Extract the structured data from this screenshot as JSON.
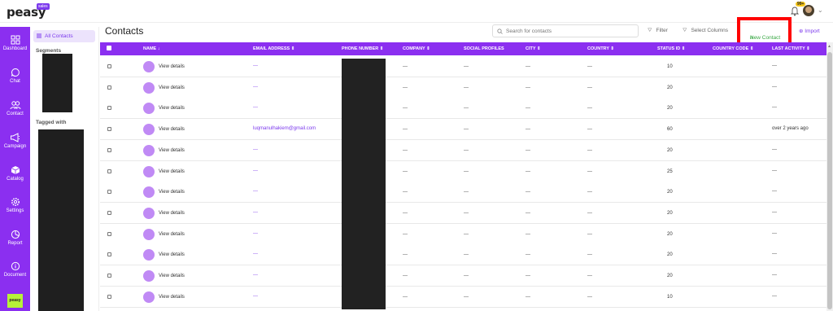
{
  "app": {
    "logo": "peasy",
    "logo_badge": "sales",
    "new_badge": "99+"
  },
  "nav": [
    {
      "label": "Dashboard",
      "icon": "grid-icon"
    },
    {
      "label": "Chat",
      "icon": "chat-icon"
    },
    {
      "label": "Contact",
      "icon": "contacts-icon"
    },
    {
      "label": "Campaign",
      "icon": "megaphone-icon"
    },
    {
      "label": "Catalog",
      "icon": "box-icon"
    },
    {
      "label": "Settings",
      "icon": "gear-icon"
    },
    {
      "label": "Report",
      "icon": "pie-chart-icon"
    },
    {
      "label": "Document",
      "icon": "info-icon"
    }
  ],
  "nav_bottom_logo": "peasy",
  "segments": {
    "all_contacts": "All Contacts",
    "segments_heading": "Segments",
    "tagged_heading": "Tagged with"
  },
  "page": {
    "title": "Contacts",
    "search_placeholder": "Search for contacts",
    "filter": "Filter",
    "select_columns": "Select Columns",
    "new_contact": "New Contact",
    "import": "Import"
  },
  "table": {
    "columns": [
      "NAME",
      "EMAIL ADDRESS",
      "PHONE NUMBER",
      "COMPANY",
      "SOCIAL PROFILES",
      "CITY",
      "COUNTRY",
      "STATUS ID",
      "COUNTRY CODE",
      "LAST ACTIVITY"
    ],
    "view_label": "View details",
    "rows": [
      {
        "email": "---",
        "company": "---",
        "social": "---",
        "city": "---",
        "country": "---",
        "status": "10",
        "code": "",
        "activity": "---"
      },
      {
        "email": "---",
        "company": "---",
        "social": "---",
        "city": "---",
        "country": "---",
        "status": "20",
        "code": "",
        "activity": "---"
      },
      {
        "email": "---",
        "company": "---",
        "social": "---",
        "city": "---",
        "country": "---",
        "status": "20",
        "code": "",
        "activity": "---"
      },
      {
        "email": "luqmanulhakiem@gmail.com",
        "company": "---",
        "social": "---",
        "city": "---",
        "country": "---",
        "status": "60",
        "code": "",
        "activity": "over 2 years ago"
      },
      {
        "email": "---",
        "company": "---",
        "social": "---",
        "city": "---",
        "country": "---",
        "status": "20",
        "code": "",
        "activity": "---"
      },
      {
        "email": "---",
        "company": "---",
        "social": "---",
        "city": "---",
        "country": "---",
        "status": "25",
        "code": "",
        "activity": "---"
      },
      {
        "email": "---",
        "company": "---",
        "social": "---",
        "city": "---",
        "country": "---",
        "status": "20",
        "code": "",
        "activity": "---"
      },
      {
        "email": "---",
        "company": "---",
        "social": "---",
        "city": "---",
        "country": "---",
        "status": "20",
        "code": "",
        "activity": "---"
      },
      {
        "email": "---",
        "company": "---",
        "social": "---",
        "city": "---",
        "country": "---",
        "status": "20",
        "code": "",
        "activity": "---"
      },
      {
        "email": "---",
        "company": "---",
        "social": "---",
        "city": "---",
        "country": "---",
        "status": "20",
        "code": "",
        "activity": "---"
      },
      {
        "email": "---",
        "company": "---",
        "social": "---",
        "city": "---",
        "country": "---",
        "status": "20",
        "code": "",
        "activity": "---"
      },
      {
        "email": "---",
        "company": "---",
        "social": "---",
        "city": "---",
        "country": "---",
        "status": "10",
        "code": "",
        "activity": "---"
      }
    ]
  },
  "colors": {
    "primary": "#8b2ff0",
    "accent": "#7c3aed",
    "highlight_box": "#ff0000",
    "new_contact_text": "#3aa845"
  }
}
